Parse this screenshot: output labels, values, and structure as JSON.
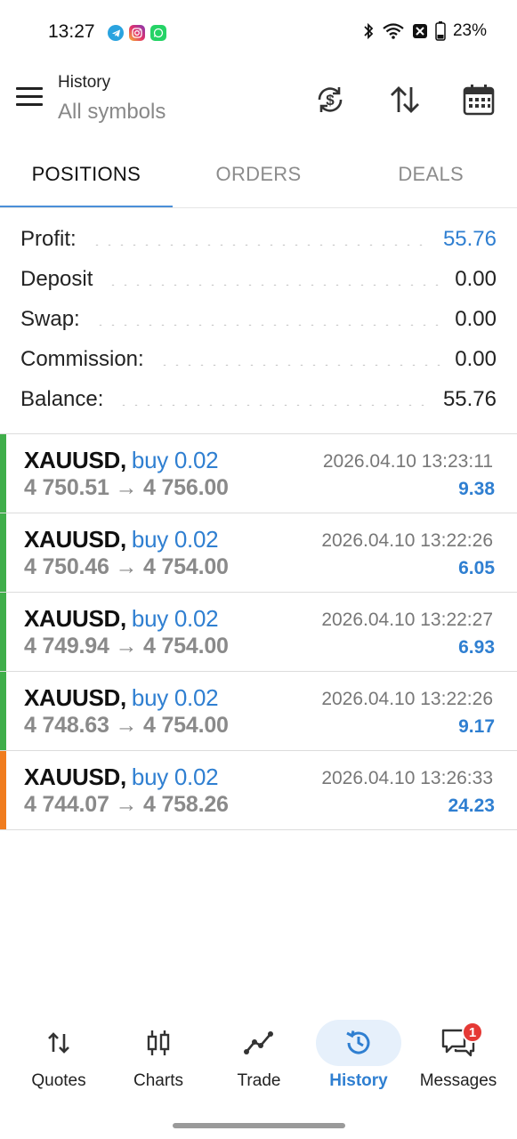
{
  "status_bar": {
    "time": "13:27",
    "battery": "23%",
    "apps": [
      "telegram-icon",
      "instagram-icon",
      "whatsapp-icon"
    ],
    "icons": [
      "bluetooth-icon",
      "wifi-icon",
      "nfc-icon",
      "battery-icon"
    ]
  },
  "header": {
    "title": "History",
    "subtitle": "All symbols"
  },
  "tabs": [
    {
      "label": "POSITIONS",
      "active": true
    },
    {
      "label": "ORDERS",
      "active": false
    },
    {
      "label": "DEALS",
      "active": false
    }
  ],
  "summary": [
    {
      "label": "Profit:",
      "value": "55.76",
      "highlight": true
    },
    {
      "label": "Deposit",
      "value": "0.00",
      "highlight": false
    },
    {
      "label": "Swap:",
      "value": "0.00",
      "highlight": false
    },
    {
      "label": "Commission:",
      "value": "0.00",
      "highlight": false
    },
    {
      "label": "Balance:",
      "value": "55.76",
      "highlight": false
    }
  ],
  "positions": [
    {
      "symbol": "XAUUSD,",
      "side": "buy 0.02",
      "datetime": "2026.04.10 13:23:11",
      "prices": "4 750.51 → 4 756.00",
      "profit": "9.38",
      "bar_color": "#3fae4a"
    },
    {
      "symbol": "XAUUSD,",
      "side": "buy 0.02",
      "datetime": "2026.04.10 13:22:26",
      "prices": "4 750.46 → 4 754.00",
      "profit": "6.05",
      "bar_color": "#3fae4a"
    },
    {
      "symbol": "XAUUSD,",
      "side": "buy 0.02",
      "datetime": "2026.04.10 13:22:27",
      "prices": "4 749.94 → 4 754.00",
      "profit": "6.93",
      "bar_color": "#3fae4a"
    },
    {
      "symbol": "XAUUSD,",
      "side": "buy 0.02",
      "datetime": "2026.04.10 13:22:26",
      "prices": "4 748.63 → 4 754.00",
      "profit": "9.17",
      "bar_color": "#3fae4a"
    },
    {
      "symbol": "XAUUSD,",
      "side": "buy 0.02",
      "datetime": "2026.04.10 13:26:33",
      "prices": "4 744.07 → 4 758.26",
      "profit": "24.23",
      "bar_color": "#f07c1e"
    }
  ],
  "bottom_nav": [
    {
      "label": "Quotes",
      "icon": "quotes-arrows-icon",
      "active": false
    },
    {
      "label": "Charts",
      "icon": "candlestick-icon",
      "active": false
    },
    {
      "label": "Trade",
      "icon": "trend-line-icon",
      "active": false
    },
    {
      "label": "History",
      "icon": "history-clock-icon",
      "active": true
    },
    {
      "label": "Messages",
      "icon": "messages-icon",
      "active": false,
      "badge": "1"
    }
  ],
  "colors": {
    "accent": "#2f7fd1",
    "tab_indicator": "#4a8fd8",
    "buy_bar": "#3fae4a",
    "alt_bar": "#f07c1e",
    "badge": "#e53935"
  }
}
